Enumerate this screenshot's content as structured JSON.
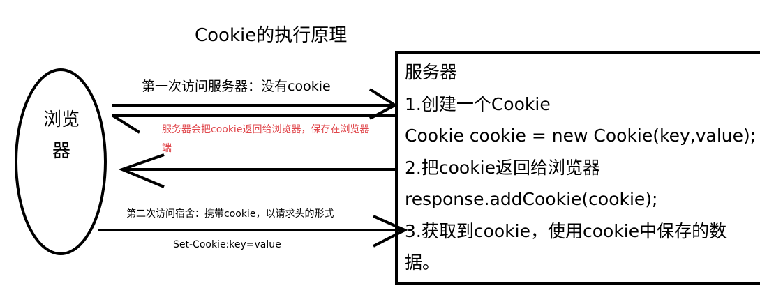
{
  "title": "Cookie的执行原理",
  "browser": {
    "label": "浏览器"
  },
  "arrows": {
    "request_first": "第一次访问服务器：没有cookie",
    "response_note": "服务器会把cookie返回给浏览器，保存在浏览器端",
    "request_second": "第二次访问宿舍：携带cookie，以请求头的形式",
    "header_example": "Set-Cookie:key=value"
  },
  "server": {
    "lines": [
      "服务器",
      "1.创建一个Cookie",
      "Cookie cookie = new Cookie(key,value);",
      "2.把cookie返回给浏览器",
      "response.addCookie(cookie);",
      "3.获取到cookie，使用cookie中保存的数据。"
    ]
  }
}
